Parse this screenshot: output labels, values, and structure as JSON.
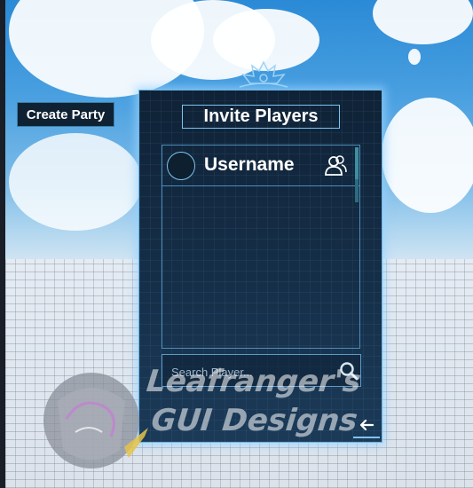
{
  "sidebar": {
    "create_party_label": "Create Party"
  },
  "panel": {
    "title": "Invite Players",
    "players": [
      {
        "username": "Username"
      }
    ],
    "search": {
      "placeholder": "Search Player...",
      "value": ""
    },
    "invite_icon": "add-friend-icon",
    "back_icon": "arrow-left-icon"
  },
  "watermark": {
    "line1": "Leafranger's",
    "line2": "GUI Designs"
  },
  "colors": {
    "panel_bg": "#16304a",
    "panel_glow": "#96d2ff",
    "border_accent": "#7cc4ef",
    "text": "#ffffff"
  }
}
